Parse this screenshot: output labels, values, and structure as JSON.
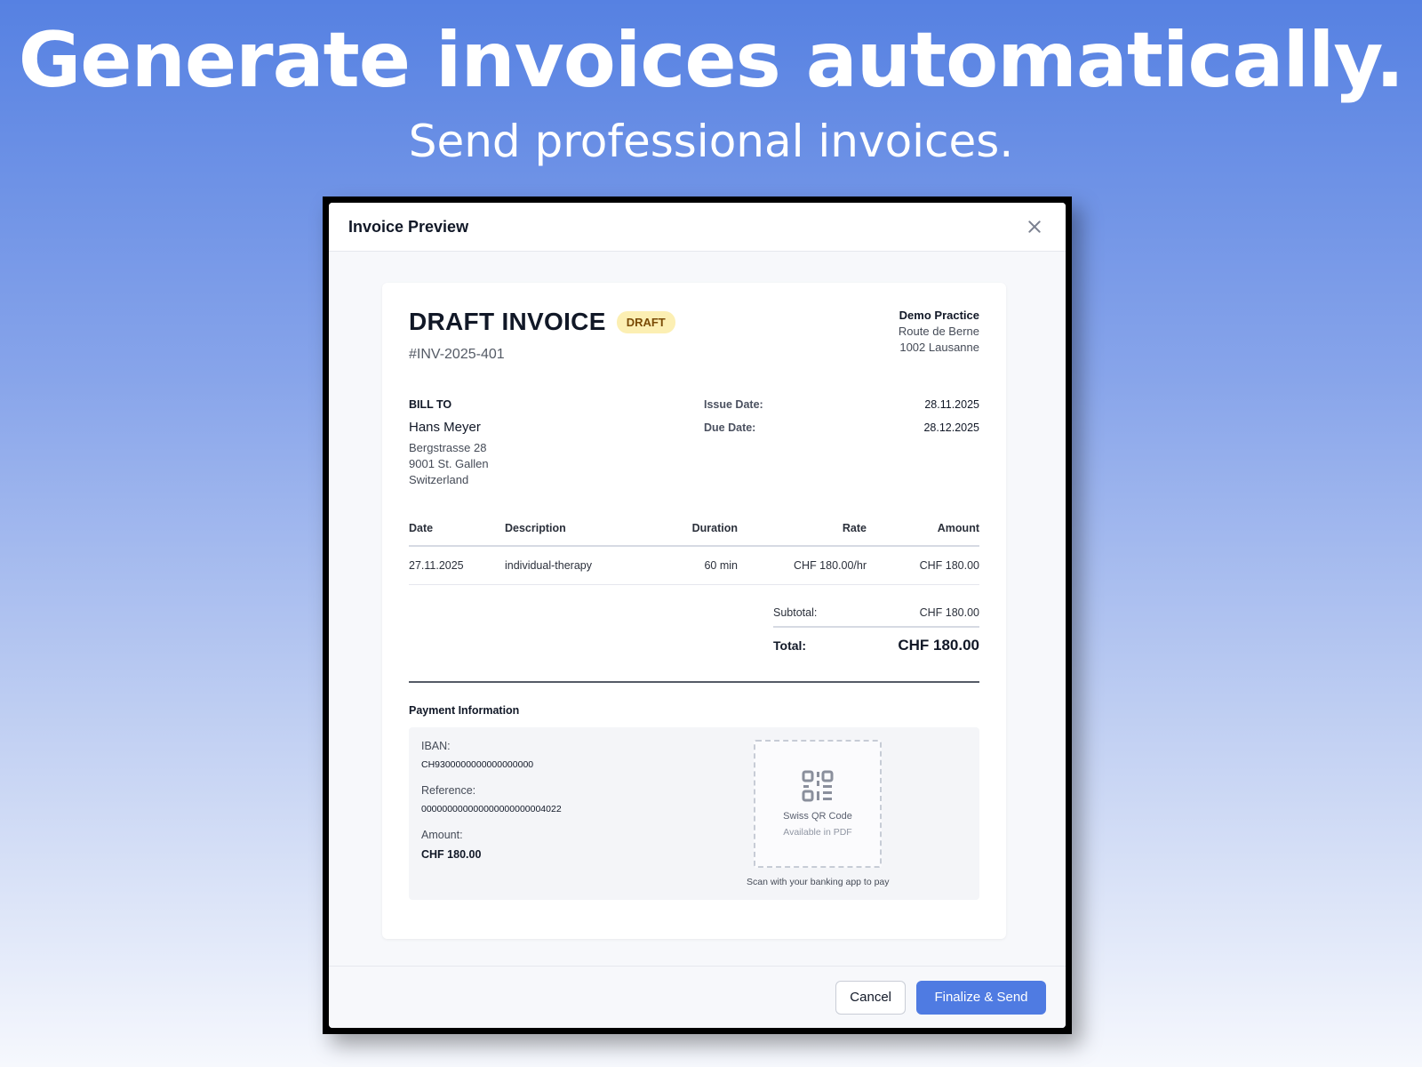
{
  "hero": {
    "headline": "Generate invoices automatically.",
    "subheadline": "Send professional invoices."
  },
  "modal": {
    "title": "Invoice Preview",
    "close_icon": "close-icon"
  },
  "invoice": {
    "title": "DRAFT INVOICE",
    "badge": "DRAFT",
    "number": "#INV-2025-401",
    "practice": {
      "name": "Demo Practice",
      "street": "Route de Berne",
      "city": "1002 Lausanne"
    },
    "bill_to": {
      "label": "BILL TO",
      "name": "Hans Meyer",
      "street": "Bergstrasse 28",
      "city": "9001 St. Gallen",
      "country": "Switzerland"
    },
    "dates": {
      "issue_label": "Issue Date:",
      "issue_value": "28.11.2025",
      "due_label": "Due Date:",
      "due_value": "28.12.2025"
    },
    "table": {
      "headers": {
        "date": "Date",
        "description": "Description",
        "duration": "Duration",
        "rate": "Rate",
        "amount": "Amount"
      },
      "rows": [
        {
          "date": "27.11.2025",
          "description": "individual-therapy",
          "duration": "60 min",
          "rate": "CHF 180.00/hr",
          "amount": "CHF 180.00"
        }
      ]
    },
    "totals": {
      "subtotal_label": "Subtotal:",
      "subtotal_value": "CHF 180.00",
      "total_label": "Total:",
      "total_value": "CHF 180.00"
    },
    "payment": {
      "title": "Payment Information",
      "iban_label": "IBAN:",
      "iban_value": "CH9300000000000000000",
      "reference_label": "Reference:",
      "reference_value": "000000000000000000000004022",
      "amount_label": "Amount:",
      "amount_value": "CHF 180.00",
      "qr_icon": "qr-code-icon",
      "qr_title": "Swiss QR Code",
      "qr_subtitle": "Available in PDF",
      "qr_caption": "Scan with your banking app to pay"
    }
  },
  "footer": {
    "cancel_label": "Cancel",
    "finalize_label": "Finalize & Send"
  },
  "colors": {
    "primary": "#4f7be2",
    "badge_bg": "#fcefb3",
    "badge_text": "#7a4b06"
  }
}
